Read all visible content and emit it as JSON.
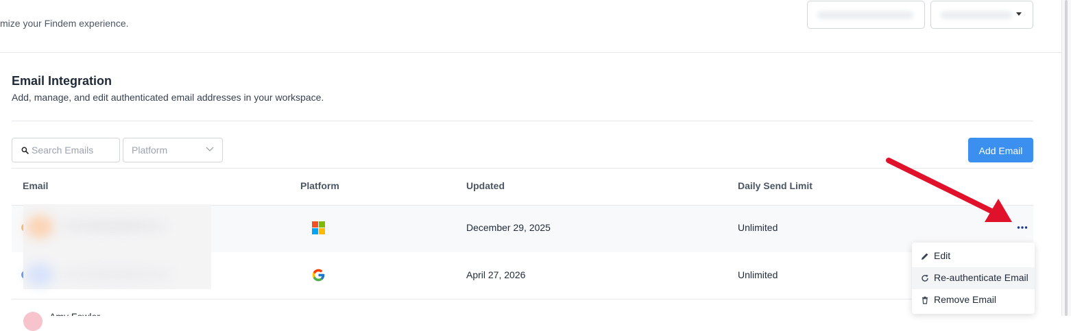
{
  "top": {
    "subtitle": "mize your Findem experience."
  },
  "section": {
    "title": "Email Integration",
    "description": "Add, manage, and edit authenticated email addresses in your workspace."
  },
  "toolbar": {
    "search_placeholder": "Search Emails",
    "platform_placeholder": "Platform",
    "add_label": "Add Email"
  },
  "table": {
    "headers": [
      "Email",
      "Platform",
      "Updated",
      "Daily Send Limit"
    ],
    "rows": [
      {
        "platform_icon": "microsoft-icon",
        "updated": "December 29, 2025",
        "limit": "Unlimited"
      },
      {
        "platform_icon": "google-icon",
        "updated": "April 27, 2026",
        "limit": "Unlimited"
      },
      {
        "name": "Amy Fowler"
      }
    ]
  },
  "menu": {
    "items": [
      {
        "label": "Edit",
        "icon": "pencil-icon"
      },
      {
        "label": "Re-authenticate Email",
        "icon": "refresh-icon"
      },
      {
        "label": "Remove Email",
        "icon": "trash-icon"
      }
    ]
  },
  "colors": {
    "accent": "#3b8fef",
    "annotation_arrow": "#e0112b",
    "more_icon": "#1e3a8a"
  }
}
